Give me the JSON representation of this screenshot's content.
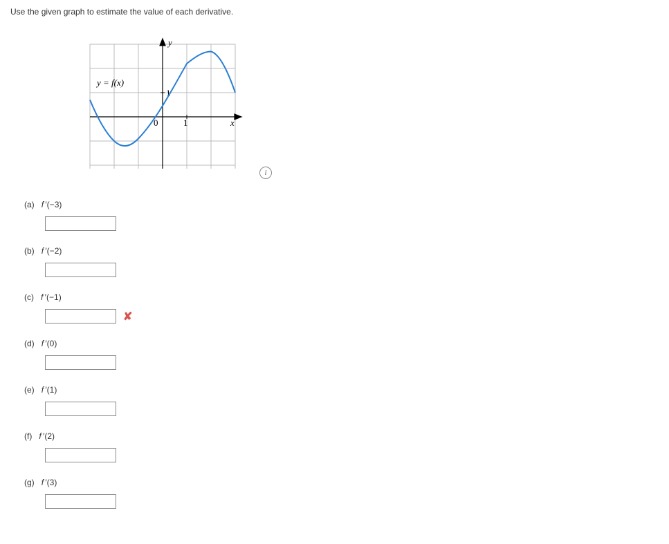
{
  "prompt": "Use the given graph to estimate the value of each derivative.",
  "graph": {
    "y_label": "y",
    "x_label": "x",
    "curve_label": "y = f(x)",
    "tick_x": "1",
    "tick_y": "1",
    "origin": "0"
  },
  "info_icon_glyph": "i",
  "questions": [
    {
      "letter": "(a)",
      "expr": "f'(−3)",
      "value": "",
      "incorrect": false
    },
    {
      "letter": "(b)",
      "expr": "f'(−2)",
      "value": "",
      "incorrect": false
    },
    {
      "letter": "(c)",
      "expr": "f'(−1)",
      "value": "",
      "incorrect": true
    },
    {
      "letter": "(d)",
      "expr": "f'(0)",
      "value": "",
      "incorrect": false
    },
    {
      "letter": "(e)",
      "expr": "f'(1)",
      "value": "",
      "incorrect": false
    },
    {
      "letter": "(f)",
      "expr": "f'(2)",
      "value": "",
      "incorrect": false
    },
    {
      "letter": "(g)",
      "expr": "f'(3)",
      "value": "",
      "incorrect": false
    }
  ],
  "chart_data": {
    "type": "line",
    "title": "",
    "xlabel": "x",
    "ylabel": "y",
    "curve_label": "y = f(x)",
    "xlim": [
      -3.2,
      3.2
    ],
    "ylim": [
      -2.2,
      3.2
    ],
    "xticks": [
      1
    ],
    "yticks": [
      1
    ],
    "series": [
      {
        "name": "f(x)",
        "x": [
          -3,
          -2.5,
          -2,
          -1.5,
          -1,
          -0.5,
          0,
          0.5,
          1,
          1.5,
          2,
          2.5,
          3
        ],
        "y": [
          0.7,
          -0.5,
          -1.0,
          -0.9,
          -0.4,
          0.2,
          0.9,
          1.6,
          2.2,
          2.6,
          2.7,
          2.2,
          1.0
        ]
      }
    ]
  }
}
